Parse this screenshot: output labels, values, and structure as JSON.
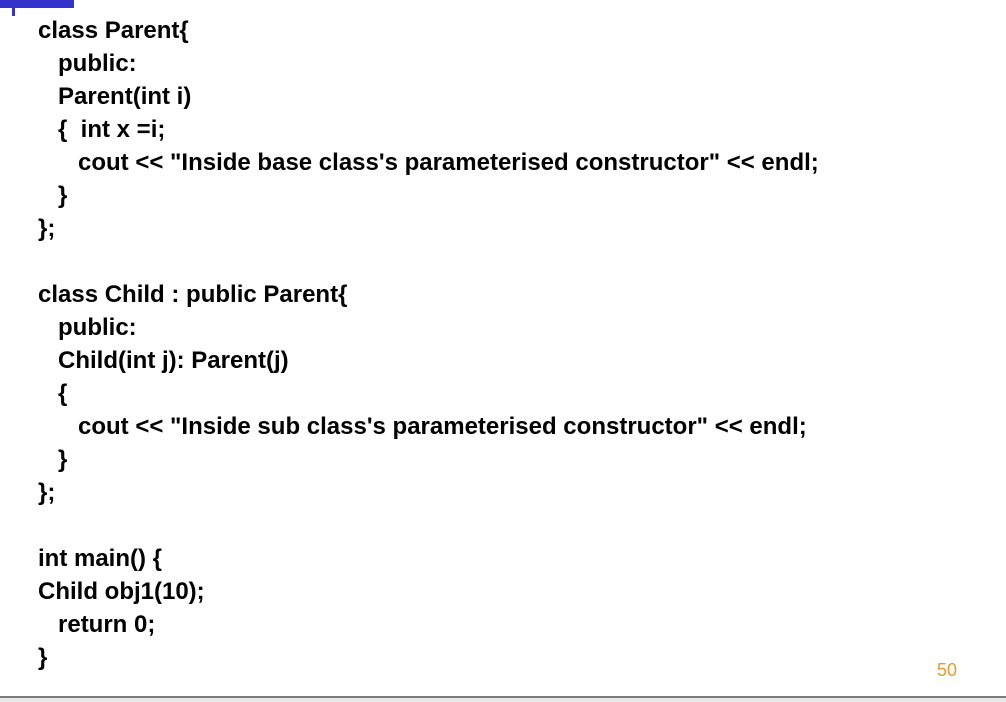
{
  "slide": {
    "code_lines": [
      "class Parent{",
      "   public:",
      "   Parent(int i)",
      "   {  int x =i;",
      "      cout << \"Inside base class's parameterised constructor\" << endl;",
      "   }",
      "};",
      "",
      "class Child : public Parent{",
      "   public:",
      "   Child(int j): Parent(j)",
      "   {",
      "      cout << \"Inside sub class's parameterised constructor\" << endl;",
      "   }",
      "};",
      "",
      "int main() {",
      "Child obj1(10);",
      "   return 0;",
      "}"
    ],
    "page_number": "50",
    "accent_color": "#3333cc",
    "page_number_color": "#e69a2e"
  }
}
